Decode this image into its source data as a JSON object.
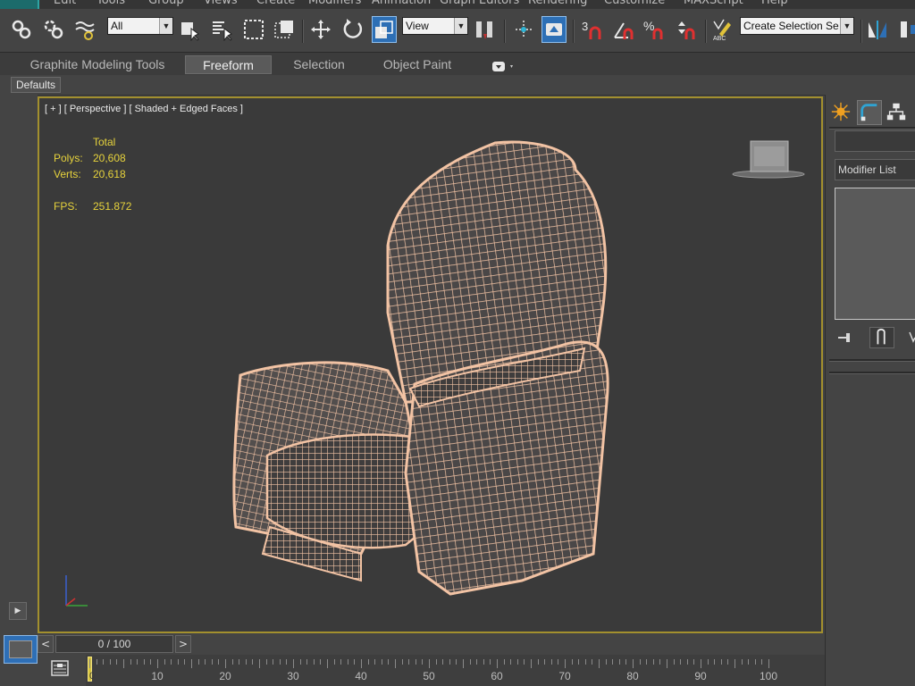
{
  "menubar": {
    "items": [
      "Edit",
      "Tools",
      "Group",
      "Views",
      "Create",
      "Modifiers",
      "Animation",
      "Graph Editors",
      "Rendering",
      "Customize",
      "MAXScript",
      "Help"
    ]
  },
  "toolbar": {
    "selection_filter": "All",
    "reference_coord": "View",
    "named_selection_placeholder": "Create Selection Se",
    "icons": [
      "select-and-link",
      "unlink-selection",
      "bind-to-space-warp",
      "select-object",
      "select-by-name",
      "rectangular-selection-region",
      "window-crossing",
      "select-and-move",
      "select-and-rotate",
      "select-and-scale",
      "use-pivot-point-center",
      "select-and-manipulate",
      "keyboard-shortcut-override",
      "snaps-toggle-3",
      "angle-snap",
      "percent-snap",
      "spinner-snap",
      "edit-named-selection-sets",
      "mirror",
      "align"
    ]
  },
  "ribbon": {
    "tabs": [
      {
        "label": "Graphite Modeling Tools",
        "selected": false
      },
      {
        "label": "Freeform",
        "selected": true
      },
      {
        "label": "Selection",
        "selected": false
      },
      {
        "label": "Object Paint",
        "selected": false
      }
    ]
  },
  "defaults_label": "Defaults",
  "viewport": {
    "label": "[ + ] [ Perspective ] [ Shaded + Edged Faces ]",
    "stats": {
      "header": "Total",
      "polys_label": "Polys:",
      "polys": "20,608",
      "verts_label": "Verts:",
      "verts": "20,618",
      "fps_label": "FPS:",
      "fps": "251.872"
    },
    "border_color": "#a3902e",
    "wire_color": "#f2c3a4"
  },
  "command_panel": {
    "tabs": [
      "create-tab",
      "modify-tab",
      "hierarchy-tab"
    ],
    "modifier_list_label": "Modifier List"
  },
  "timeline": {
    "frame_readout": "0 / 100",
    "prev_label": "<",
    "next_label": ">",
    "current_frame": "0",
    "ticks": [
      "10",
      "20",
      "30",
      "40",
      "50",
      "60",
      "70",
      "80",
      "90",
      "100"
    ]
  }
}
